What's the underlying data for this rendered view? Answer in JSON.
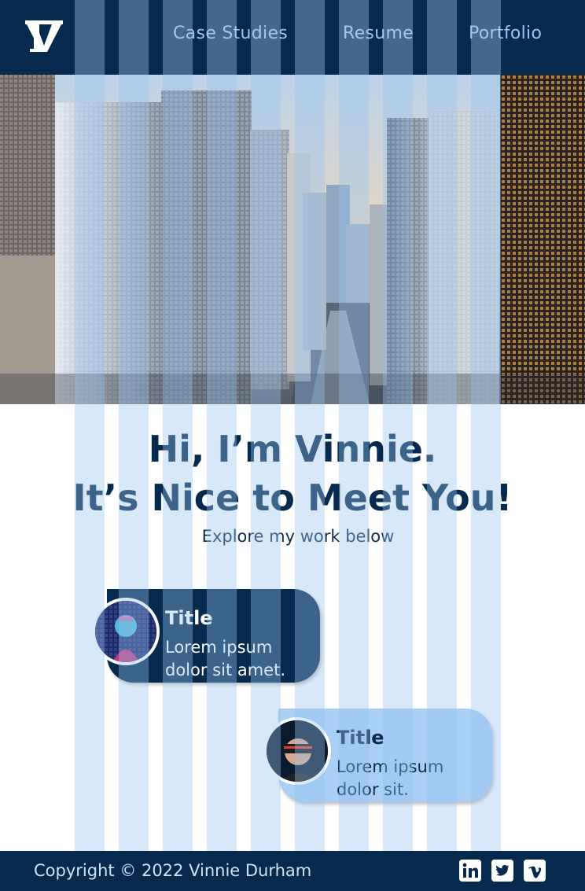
{
  "header": {
    "logo_icon": "v-monogram-logo",
    "nav": [
      {
        "label": "Case Studies"
      },
      {
        "label": "Resume"
      },
      {
        "label": "Portfolio"
      }
    ]
  },
  "hero": {
    "image": "city-skyline-photo"
  },
  "intro": {
    "headline_line1": "Hi, I’m Vinnie.",
    "headline_line2": "It’s Nice to Meet You!",
    "subhead": "Explore my work below"
  },
  "cards": [
    {
      "title": "Title",
      "text": "Lorem ipsum dolor sit amet.",
      "avatar": "woman-portrait-avatar"
    },
    {
      "title": "Title",
      "text": "Lorem ipsum dolor sit.",
      "avatar": "vr-headset-man-avatar"
    }
  ],
  "footer": {
    "copyright": "Copyright © 2022 Vinnie Durham",
    "social": [
      "linkedin-icon",
      "twitter-icon",
      "vimeo-icon"
    ]
  },
  "colors": {
    "navy": "#062a4d",
    "nav_text": "#9ec5ef",
    "light_blue_card": "#a9cff5",
    "grid_overlay": "#96c3f0"
  }
}
